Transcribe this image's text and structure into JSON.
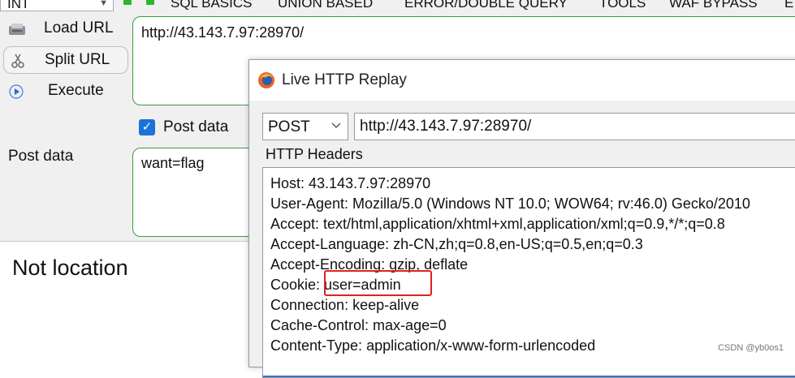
{
  "menubar": {
    "int_select": "INT",
    "items": [
      "SQL BASICS",
      "UNION BASED",
      "ERROR/DOUBLE QUERY",
      "TOOLS",
      "WAF BYPASS",
      "E"
    ]
  },
  "hackbar": {
    "load_url": "Load URL",
    "split_url": "Split URL",
    "execute": "Execute",
    "url_value": "http://43.143.7.97:28970/",
    "post_checkbox_label": "Post data",
    "post_checked": true,
    "post_label": "Post data",
    "post_value": "want=flag"
  },
  "result": {
    "text": "Not location"
  },
  "replay": {
    "title": "Live HTTP Replay",
    "method": "POST",
    "url": "http://43.143.7.97:28970/",
    "headers_label": "HTTP Headers",
    "headers": [
      "Host: 43.143.7.97:28970",
      "User-Agent: Mozilla/5.0 (Windows NT 10.0; WOW64; rv:46.0) Gecko/2010",
      "Accept: text/html,application/xhtml+xml,application/xml;q=0.9,*/*;q=0.8",
      "Accept-Language: zh-CN,zh;q=0.8,en-US;q=0.5,en;q=0.3",
      "Accept-Encoding: gzip, deflate",
      "Cookie: user=admin",
      "Connection: keep-alive",
      "Cache-Control: max-age=0",
      "Content-Type: application/x-www-form-urlencoded"
    ]
  },
  "watermark": "CSDN @yb0os1",
  "colors": {
    "highlight": "#e02020",
    "checkbox": "#1a73d9",
    "field_border": "#3c9a3c"
  }
}
